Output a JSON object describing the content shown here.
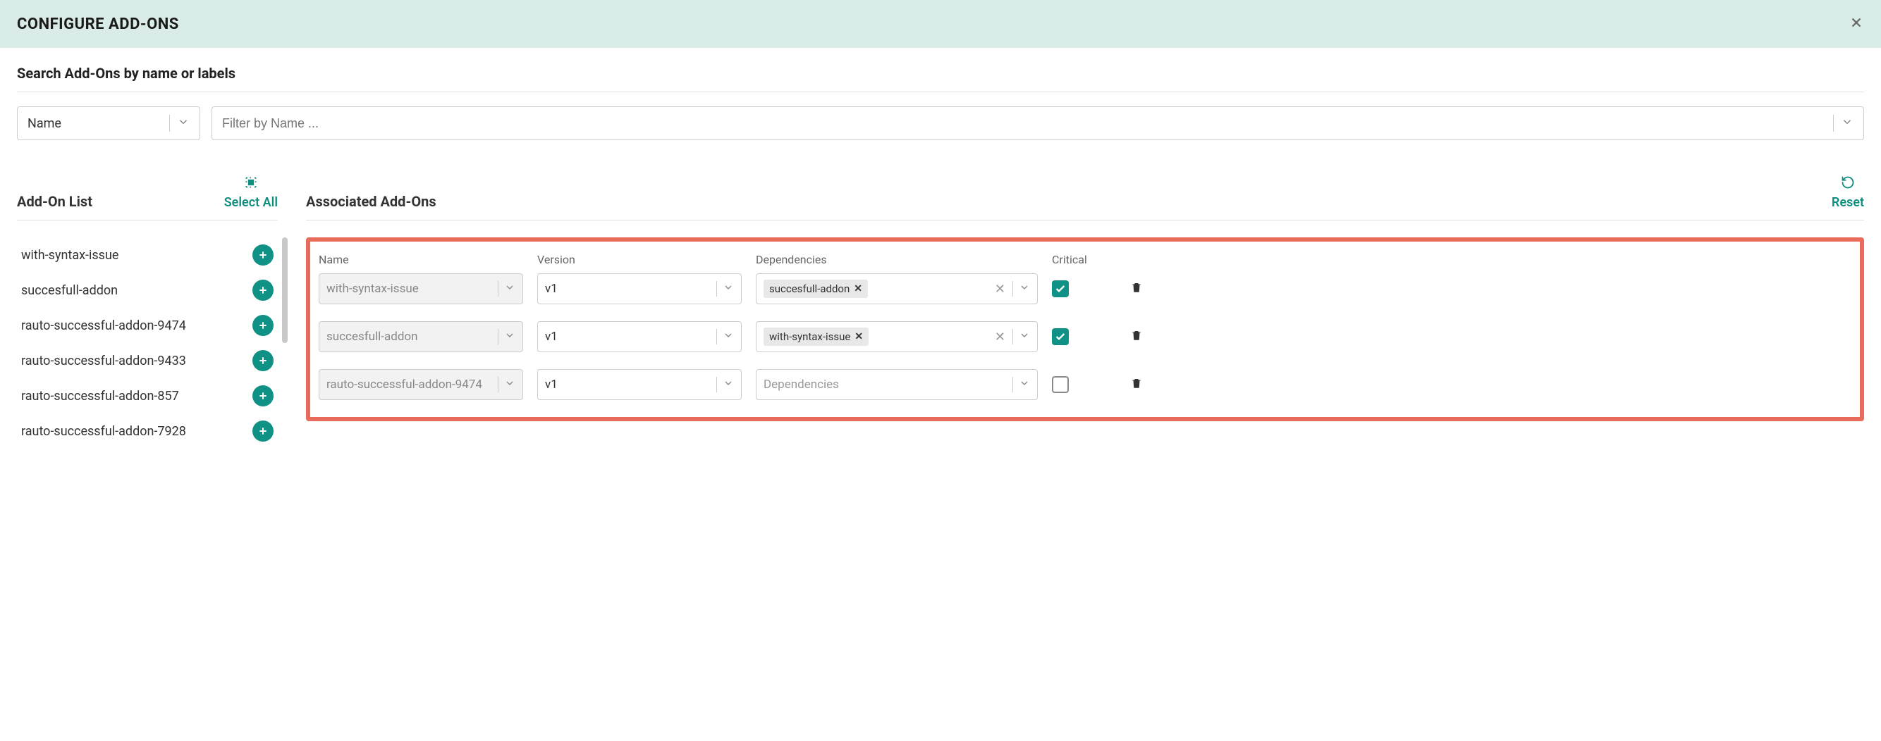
{
  "header": {
    "title": "CONFIGURE ADD-ONS"
  },
  "search": {
    "label": "Search Add-Ons by name or labels",
    "type_label": "Name",
    "filter_placeholder": "Filter by Name ..."
  },
  "addon_list": {
    "title": "Add-On List",
    "select_all": "Select All",
    "items": [
      {
        "name": "with-syntax-issue"
      },
      {
        "name": "succesfull-addon"
      },
      {
        "name": "rauto-successful-addon-9474"
      },
      {
        "name": "rauto-successful-addon-9433"
      },
      {
        "name": "rauto-successful-addon-857"
      },
      {
        "name": "rauto-successful-addon-7928"
      }
    ]
  },
  "associated": {
    "title": "Associated Add-Ons",
    "reset": "Reset",
    "columns": {
      "name": "Name",
      "version": "Version",
      "dependencies": "Dependencies",
      "critical": "Critical"
    },
    "deps_placeholder": "Dependencies",
    "rows": [
      {
        "name": "with-syntax-issue",
        "version": "v1",
        "dependencies": [
          "succesfull-addon"
        ],
        "critical": true
      },
      {
        "name": "succesfull-addon",
        "version": "v1",
        "dependencies": [
          "with-syntax-issue"
        ],
        "critical": true
      },
      {
        "name": "rauto-successful-addon-9474",
        "version": "v1",
        "dependencies": [],
        "critical": false
      }
    ]
  }
}
